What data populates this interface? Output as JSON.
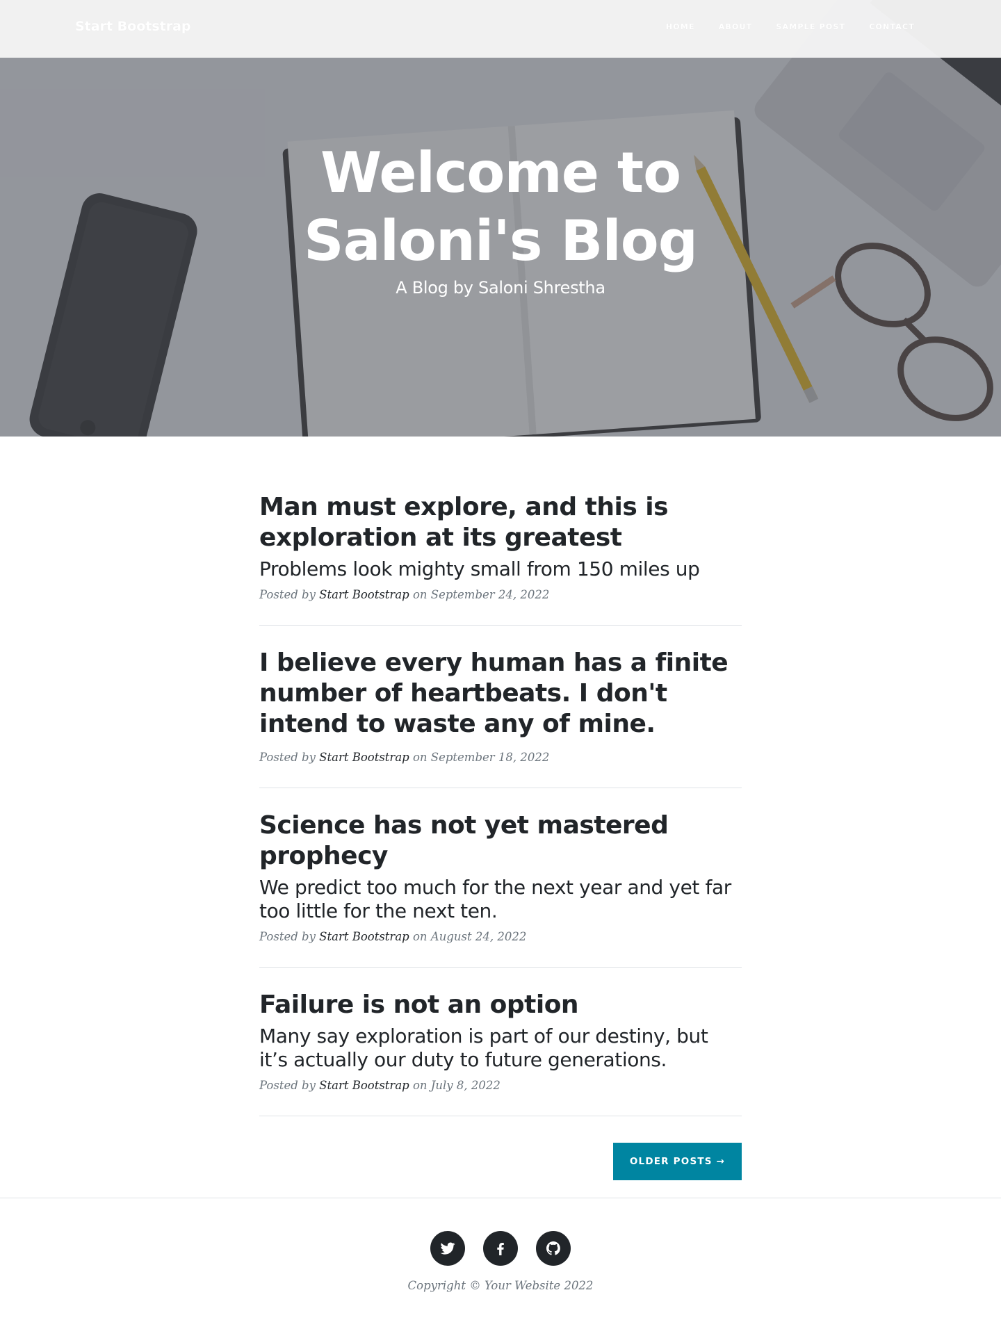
{
  "navbar": {
    "brand": "Start Bootstrap",
    "links": [
      "Home",
      "About",
      "Sample Post",
      "Contact"
    ]
  },
  "hero": {
    "title": "Welcome to Saloni's Blog",
    "subtitle": "A Blog by Saloni Shrestha"
  },
  "posts": [
    {
      "title": "Man must explore, and this is exploration at its greatest",
      "subtitle": "Problems look mighty small from 150 miles up",
      "meta_prefix": "Posted by",
      "author": "Start Bootstrap",
      "meta_on": "on September 24, 2022"
    },
    {
      "title": "I believe every human has a finite number of heartbeats. I don't intend to waste any of mine.",
      "subtitle": "",
      "meta_prefix": "Posted by",
      "author": "Start Bootstrap",
      "meta_on": "on September 18, 2022"
    },
    {
      "title": "Science has not yet mastered prophecy",
      "subtitle": "We predict too much for the next year and yet far too little for the next ten.",
      "meta_prefix": "Posted by",
      "author": "Start Bootstrap",
      "meta_on": "on August 24, 2022"
    },
    {
      "title": "Failure is not an option",
      "subtitle": "Many say exploration is part of our destiny, but it’s actually our duty to future generations.",
      "meta_prefix": "Posted by",
      "author": "Start Bootstrap",
      "meta_on": "on July 8, 2022"
    }
  ],
  "pager": {
    "older_label": "Older Posts →"
  },
  "footer": {
    "social": [
      "twitter-icon",
      "facebook-icon",
      "github-icon"
    ],
    "copyright": "Copyright © Your Website 2022"
  },
  "colors": {
    "accent": "#0085a1",
    "text": "#212529",
    "muted": "#6c757d"
  }
}
